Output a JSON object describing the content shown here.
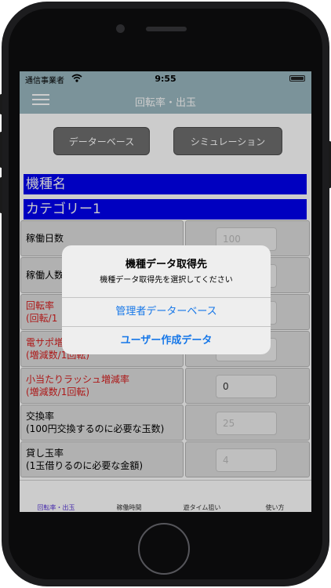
{
  "status_bar": {
    "carrier": "通信事業者",
    "time": "9:55"
  },
  "nav": {
    "title": "回転率・出玉"
  },
  "buttons": {
    "database": "データーベース",
    "simulation": "シミュレーション"
  },
  "machine": {
    "name": "機種名",
    "category": "カテゴリー1"
  },
  "rows": [
    {
      "label_line1": "稼働日数",
      "label_line2": "",
      "value": "100",
      "is_placeholder": true,
      "red": false
    },
    {
      "label_line1": "稼働人数",
      "label_line2": "",
      "value": "",
      "is_placeholder": true,
      "red": false
    },
    {
      "label_line1": "回転率",
      "label_line2": "(回転/1",
      "value": "",
      "is_placeholder": true,
      "red": true
    },
    {
      "label_line1": "電サポ増",
      "label_line2": "(増減数/1回転)",
      "value": "",
      "is_placeholder": true,
      "red": true
    },
    {
      "label_line1": "小当たりラッシュ増減率",
      "label_line2": "(増減数/1回転)",
      "value": "0",
      "is_placeholder": false,
      "red": true
    },
    {
      "label_line1": "交換率",
      "label_line2": "(100円交換するのに必要な玉数)",
      "value": "25",
      "is_placeholder": true,
      "red": false
    },
    {
      "label_line1": "貸し玉率",
      "label_line2": "(1玉借りるのに必要な金額)",
      "value": "4",
      "is_placeholder": true,
      "red": false
    }
  ],
  "tabs": [
    {
      "label": "回転率・出玉",
      "active": true
    },
    {
      "label": "稼働時間",
      "active": false
    },
    {
      "label": "遊タイム狙い",
      "active": false
    },
    {
      "label": "使い方",
      "active": false
    }
  ],
  "alert": {
    "title": "機種データ取得先",
    "message": "機種データ取得先を選択してください",
    "actions": [
      "管理者データーベース",
      "ユーザー作成データ"
    ]
  },
  "colors": {
    "navbar": "#9ab8c1",
    "blue_bar": "#0000f0",
    "red_label": "#d81e1e",
    "alert_action": "#1677e8",
    "active_tab": "#5b39d8"
  }
}
